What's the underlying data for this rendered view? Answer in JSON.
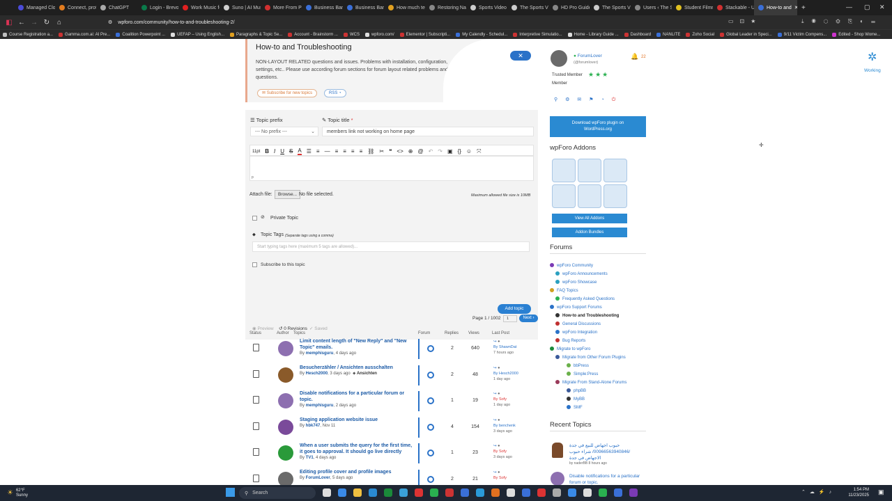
{
  "browser": {
    "tabs": [
      {
        "label": "Managed Clo",
        "color": "#4b4bd8"
      },
      {
        "label": "Connect, prot",
        "color": "#e27c1f"
      },
      {
        "label": "ChatGPT",
        "color": "#aaaaaa"
      },
      {
        "label": "Login - Brevo",
        "color": "#0a7a4a"
      },
      {
        "label": "Work Music fo",
        "color": "#e02020"
      },
      {
        "label": "Suno | AI Mus",
        "color": "#d0d0d0"
      },
      {
        "label": "More From Pu",
        "color": "#d03030"
      },
      {
        "label": "Business Banki",
        "color": "#3a6fd8"
      },
      {
        "label": "Business Banki",
        "color": "#3a6fd8"
      },
      {
        "label": "How much tec",
        "color": "#e0a020"
      },
      {
        "label": "Restoring Nat",
        "color": "#888888"
      },
      {
        "label": "Sports Video A",
        "color": "#cccccc"
      },
      {
        "label": "The Sports Vid",
        "color": "#cccccc"
      },
      {
        "label": "HD Pro Guide",
        "color": "#888888"
      },
      {
        "label": "The Sports Vid",
        "color": "#cccccc"
      },
      {
        "label": "Users ‹ The Sp",
        "color": "#888888"
      },
      {
        "label": "Student Filmm",
        "color": "#e0c020"
      },
      {
        "label": "Stackable - Ul",
        "color": "#d03030"
      },
      {
        "label": "How-to and",
        "color": "#3a6fd8"
      }
    ],
    "url": "wpforo.com/community/how-to-and-troubleshooting-2/",
    "bookmarks": [
      {
        "label": "Course Registration a...",
        "color": "#c0c0c0"
      },
      {
        "label": "Gamma.com.ai: AI Pre...",
        "color": "#c33"
      },
      {
        "label": "Coalition Powerpoint ...",
        "color": "#3a6fd8"
      },
      {
        "label": "UEFAP – Using English...",
        "color": "#ddd"
      },
      {
        "label": "Paragraphs & Topic Se...",
        "color": "#e0a020"
      },
      {
        "label": "Account - Brainstorm ...",
        "color": "#c33"
      },
      {
        "label": "WCS",
        "color": "#c33"
      },
      {
        "label": "wpforo.com/",
        "color": "#ddd"
      },
      {
        "label": "Elementor | Subscripti...",
        "color": "#c33"
      },
      {
        "label": "My Calendly - Schedul...",
        "color": "#3a6fd8"
      },
      {
        "label": "Interpretive Simulatio...",
        "color": "#c33"
      },
      {
        "label": "Home - Library Guide ...",
        "color": "#ddd"
      },
      {
        "label": "Dashboard",
        "color": "#c33"
      },
      {
        "label": "NANLITE",
        "color": "#3a6fd8"
      },
      {
        "label": "Zoho Social",
        "color": "#c33"
      },
      {
        "label": "Global Leader in Speci...",
        "color": "#c33"
      },
      {
        "label": "9/11 Victim Compens...",
        "color": "#3a6fd8"
      },
      {
        "label": "Edited - Shop Wome...",
        "color": "#c3c"
      }
    ]
  },
  "header_card": {
    "title": "How-to and Troubleshooting",
    "description": "NON-LAYOUT RELATED questions and issues. Problems with installation, configuration, settings, etc.. Please use according forum sections for forum layout related problems and questions.",
    "subscribe_label": "Subscribe for new topics",
    "rss_label": "RSS",
    "close_label": "✕"
  },
  "new_topic": {
    "prefix_label": "Topic prefix",
    "prefix_value": "--- No prefix ---",
    "title_label": "Topic title",
    "title_value": "members link not working on home page",
    "editor_p": "p",
    "editor_size": "11pt",
    "attach_label": "Attach file:",
    "browse_label": "Browse...",
    "no_file": "No file selected.",
    "max_size": "Maximum allowed file size is 10MB",
    "private_label": "Private Topic",
    "tags_label": "Topic Tags",
    "tags_hint": "(Separate tags using a comma)",
    "tags_placeholder": "Start typing tags here (maximum 5 tags are allowed)...",
    "subscribe_label": "Subscribe to this topic",
    "add_label": "Add topic",
    "preview_label": "Preview",
    "revisions_label": "0 Revisions",
    "saved_label": "Saved"
  },
  "pagination": {
    "label": "Page 1 / 1002",
    "page": "1",
    "next": "Next"
  },
  "table": {
    "headers": {
      "status": "Status",
      "author": "Author",
      "topics": "Topics",
      "forum": "Forum",
      "replies": "Replies",
      "views": "Views",
      "last": "Last Post"
    },
    "rows": [
      {
        "title": "Limit content length of \"New Reply\" and \"New Topic\" emails.",
        "author": "memphisguru",
        "age": "4 days ago",
        "tag": "",
        "replies": "2",
        "views": "640",
        "last_user": "ShawnDat",
        "last_time": "7 hours ago",
        "avatar": "#8d6fb0"
      },
      {
        "title": "Besucherzähler / Ansichten ausschalten",
        "author": "Hesch2000",
        "age": "3 days ago",
        "tag": "Ansichten",
        "replies": "2",
        "views": "48",
        "last_user": "Hesch2000",
        "last_time": "1 day ago",
        "avatar": "#8a5a2a"
      },
      {
        "title": "Disable notifications for a particular forum or topic.",
        "author": "memphisguru",
        "age": "2 days ago",
        "tag": "",
        "replies": "1",
        "views": "19",
        "last_user": "Sofy",
        "last_time": "1 day ago",
        "avatar": "#8d6fb0"
      },
      {
        "title": "Staging application website issue",
        "author": "hbk747",
        "age": "Nov 11",
        "tag": "",
        "replies": "4",
        "views": "154",
        "last_user": "benchenk",
        "last_time": "3 days ago",
        "avatar": "#7a4a9a"
      },
      {
        "title": "When a user submits the query for the first time, it goes to approval. It should go live directly",
        "author": "TV1",
        "age": "4 days ago",
        "tag": "",
        "replies": "1",
        "views": "23",
        "last_user": "Sofy",
        "last_time": "3 days ago",
        "avatar": "#2a9a3a"
      },
      {
        "title": "Editing profile cover and profile images",
        "author": "ForumLover",
        "age": "5 days ago",
        "tag": "",
        "replies": "2",
        "views": "21",
        "last_user": "Sofy",
        "last_time": "",
        "avatar": "#6a6a6a"
      }
    ]
  },
  "sidebar": {
    "user": {
      "name": "ForumLover",
      "handle": "(@forumlover)",
      "role": "Trusted Member",
      "role2": "Member",
      "notifications": "22"
    },
    "download_label": "Download wpForo plugin on WordPress.org",
    "addons_title": "wpForo Addons",
    "view_addons": "View All Addons",
    "addon_bundles": "Addon Bundles",
    "forums_title": "Forums",
    "forums": [
      {
        "label": "wpForo Community",
        "level": 0,
        "color": "#7a3ab5",
        "bold": false
      },
      {
        "label": "wpForo Announcements",
        "level": 1,
        "color": "#2aa0c0",
        "bold": false
      },
      {
        "label": "wpForo Showcase",
        "level": 1,
        "color": "#2aa0c0",
        "bold": false
      },
      {
        "label": "FAQ Topics",
        "level": 0,
        "color": "#d0a020",
        "bold": false
      },
      {
        "label": "Frequently Asked Questions",
        "level": 1,
        "color": "#2ab050",
        "bold": false
      },
      {
        "label": "wpForo Support Forums",
        "level": 0,
        "color": "#2a72c8",
        "bold": false
      },
      {
        "label": "How-to and Troubleshooting",
        "level": 1,
        "color": "#333333",
        "bold": true
      },
      {
        "label": "General Discussions",
        "level": 1,
        "color": "#c03030",
        "bold": false
      },
      {
        "label": "wpForo Integration",
        "level": 1,
        "color": "#2a72c8",
        "bold": false
      },
      {
        "label": "Bug Reports",
        "level": 1,
        "color": "#c03030",
        "bold": false
      },
      {
        "label": "Migrate to wpForo",
        "level": 0,
        "color": "#1a8a3a",
        "bold": false
      },
      {
        "label": "Migrate from Other Forum Plugins",
        "level": 1,
        "color": "#3a5a9a",
        "bold": false
      },
      {
        "label": "bbPress",
        "level": 2,
        "color": "#6ab04a",
        "bold": false
      },
      {
        "label": "Simple:Press",
        "level": 2,
        "color": "#6ab04a",
        "bold": false
      },
      {
        "label": "Migrate From Stand-Alone Forums",
        "level": 1,
        "color": "#9a3a5a",
        "bold": false
      },
      {
        "label": "phpBB",
        "level": 2,
        "color": "#3a5a9a",
        "bold": false
      },
      {
        "label": "MyBB",
        "level": 2,
        "color": "#333333",
        "bold": false
      },
      {
        "label": "SMF",
        "level": 2,
        "color": "#2a72c8",
        "bold": false
      }
    ],
    "recent_title": "Recent Topics",
    "recent": [
      {
        "title": "حبوب اجهاض للبيع في جدة /00966563940846/ شراء حبوب الاجهاض في جدة",
        "by": "naderBB",
        "age": "8 hours ago"
      },
      {
        "title": "Disable notifications for a particular forum or topic.",
        "by": "",
        "age": ""
      }
    ]
  },
  "working_label": "Working",
  "taskbar": {
    "weather_temp": "62°F",
    "weather_desc": "Sunny",
    "search": "Search",
    "time": "1:54 PM",
    "date": "11/23/2025"
  }
}
